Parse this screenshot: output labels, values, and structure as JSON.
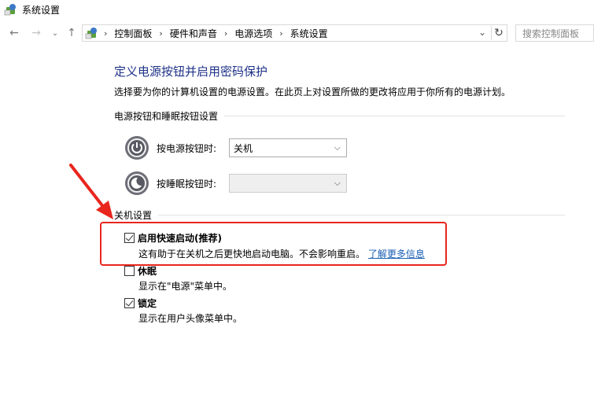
{
  "window": {
    "title": "系统设置"
  },
  "nav": {
    "breadcrumbs": [
      "控制面板",
      "硬件和声音",
      "电源选项",
      "系统设置"
    ],
    "search_placeholder": "搜索控制面板"
  },
  "page": {
    "heading": "定义电源按钮并启用密码保护",
    "description": "选择要为你的计算机设置的电源设置。在此页上对设置所做的更改将应用于你所有的电源计划。"
  },
  "power_section": {
    "title": "电源按钮和睡眠按钮设置",
    "rows": [
      {
        "label": "按电源按钮时:",
        "value": "关机"
      },
      {
        "label": "按睡眠按钮时:",
        "value": ""
      }
    ]
  },
  "shutdown_section": {
    "title": "关机设置",
    "items": [
      {
        "label": "启用快速启动(推荐)",
        "checked": true,
        "desc": "这有助于在关机之后更快地启动电脑。不会影响重启。",
        "link": "了解更多信息"
      },
      {
        "label": "休眠",
        "checked": false,
        "desc": "显示在\"电源\"菜单中。"
      },
      {
        "label": "锁定",
        "checked": true,
        "desc": "显示在用户头像菜单中。"
      }
    ]
  },
  "colors": {
    "heading": "#1e3287",
    "highlight": "#e8261e",
    "link": "#1a5fb4"
  }
}
